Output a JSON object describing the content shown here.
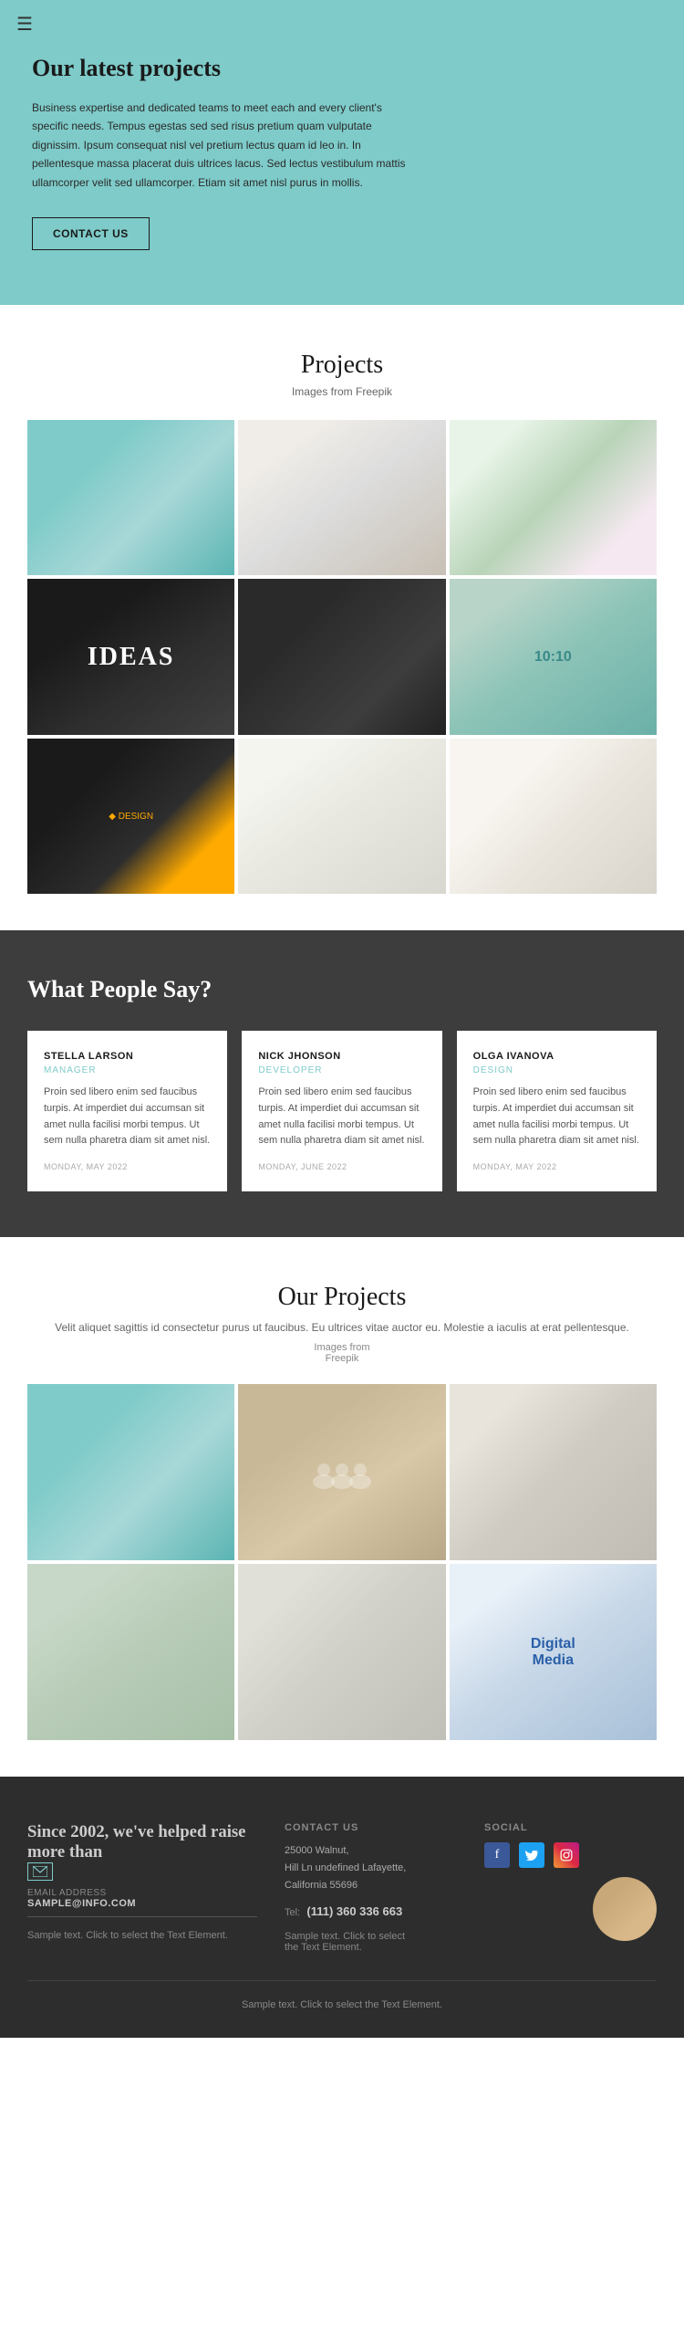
{
  "hamburger": "☰",
  "hero": {
    "title": "Our latest projects",
    "description": "Business expertise and dedicated teams to meet each and every client's specific needs. Tempus egestas sed sed risus pretium quam vulputate dignissim. Ipsum consequat nisl vel pretium lectus quam id leo in. In pellentesque massa placerat duis ultrices lacus. Sed lectus vestibulum mattis ullamcorper velit sed ullamcorper. Etiam sit amet nisl purus in mollis.",
    "contact_btn": "CONTACT US"
  },
  "projects_section": {
    "title": "Projects",
    "subtitle": "Images from Freepik",
    "images": [
      {
        "id": "books-teal",
        "alt": "Teal books"
      },
      {
        "id": "business-card-bw",
        "alt": "Business cards black white"
      },
      {
        "id": "book-colorful",
        "alt": "Colorful hardcover book"
      },
      {
        "id": "laptop-ideas",
        "alt": "Laptop with IDEAS text"
      },
      {
        "id": "card-dark",
        "alt": "Dark business card"
      },
      {
        "id": "phone",
        "alt": "Smartphone green"
      },
      {
        "id": "design-card",
        "alt": "Design business card orange"
      },
      {
        "id": "desk-lamp",
        "alt": "Desk with lamp"
      },
      {
        "id": "keyboard-top",
        "alt": "Keyboard top view"
      }
    ]
  },
  "testimonials_section": {
    "title": "What People Say?",
    "testimonials": [
      {
        "name": "STELLA LARSON",
        "role": "MANAGER",
        "text": "Proin sed libero enim sed faucibus turpis. At imperdiet dui accumsan sit amet nulla facilisi morbi tempus. Ut sem nulla pharetra diam sit amet nisl.",
        "date": "MONDAY, MAY 2022"
      },
      {
        "name": "NICK JHONSON",
        "role": "DEVELOPER",
        "text": "Proin sed libero enim sed faucibus turpis. At imperdiet dui accumsan sit amet nulla facilisi morbi tempus. Ut sem nulla pharetra diam sit amet nisl.",
        "date": "MONDAY, JUNE 2022"
      },
      {
        "name": "OLGA IVANOVA",
        "role": "DESIGN",
        "text": "Proin sed libero enim sed faucibus turpis. At imperdiet dui accumsan sit amet nulla facilisi morbi tempus. Ut sem nulla pharetra diam sit amet nisl.",
        "date": "MONDAY, MAY 2022"
      }
    ]
  },
  "our_projects_section": {
    "title": "Our Projects",
    "description": "Velit aliquet sagittis id consectetur purus ut faucibus. Eu ultrices vitae auctor eu. Molestie a iaculis at erat pellentesque.",
    "img_source": "Images from\nFreepik",
    "images": [
      {
        "id": "books2",
        "alt": "Teal books"
      },
      {
        "id": "team",
        "alt": "Team meeting"
      },
      {
        "id": "bcard2",
        "alt": "Business card"
      },
      {
        "id": "bag",
        "alt": "Shopping bag"
      },
      {
        "id": "fold",
        "alt": "White folded paper"
      },
      {
        "id": "digital",
        "alt": "Digital Media"
      }
    ]
  },
  "footer": {
    "company_tagline": "Since 2002, we've helped raise more than",
    "email_label": "EMAIL ADDRESS",
    "email": "SAMPLE@INFO.COM",
    "contact_us_label": "CONTACT US",
    "address": "25000 Walnut,\nHill Ln undefined Lafayette,\nCalifornia 55696",
    "tel_label": "Tel:",
    "tel": "(111) 360 336 663",
    "social_label": "SOCIAL",
    "social_icons": [
      "f",
      "t",
      "i"
    ],
    "sample_text_1": "Sample text. Click to select the Text Element.",
    "sample_text_2": "Sample text. Click to select\nthe Text Element.",
    "bottom_text": "Sample text. Click to select the Text Element."
  }
}
